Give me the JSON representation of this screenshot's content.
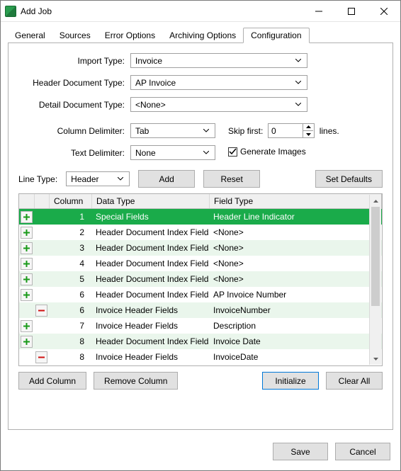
{
  "window": {
    "title": "Add Job"
  },
  "tabs": [
    "General",
    "Sources",
    "Error Options",
    "Archiving Options",
    "Configuration"
  ],
  "active_tab_index": 4,
  "form": {
    "import_type": {
      "label": "Import Type:",
      "value": "Invoice"
    },
    "header_doc_type": {
      "label": "Header Document Type:",
      "value": "AP Invoice"
    },
    "detail_doc_type": {
      "label": "Detail Document Type:",
      "value": "<None>"
    },
    "column_delim": {
      "label": "Column Delimiter:",
      "value": "Tab"
    },
    "text_delim": {
      "label": "Text Delimiter:",
      "value": "None"
    },
    "skip_first": {
      "label": "Skip first:",
      "value": "0",
      "suffix": "lines."
    },
    "generate_images": {
      "label": "Generate Images",
      "checked": true
    }
  },
  "linetype": {
    "label": "Line Type:",
    "value": "Header",
    "add_btn": "Add",
    "reset_btn": "Reset",
    "set_defaults_btn": "Set Defaults"
  },
  "grid": {
    "headers": {
      "column": "Column",
      "data_type": "Data Type",
      "field_type": "Field Type"
    },
    "rows": [
      {
        "icon": "plus",
        "col": 1,
        "data_type": "Special Fields",
        "field_type": "Header Line Indicator",
        "selected": true
      },
      {
        "icon": "plus",
        "col": 2,
        "data_type": "Header Document Index Fields",
        "field_type": "<None>"
      },
      {
        "icon": "plus",
        "col": 3,
        "data_type": "Header Document Index Fields",
        "field_type": "<None>"
      },
      {
        "icon": "plus",
        "col": 4,
        "data_type": "Header Document Index Fields",
        "field_type": "<None>"
      },
      {
        "icon": "plus",
        "col": 5,
        "data_type": "Header Document Index Fields",
        "field_type": "<None>"
      },
      {
        "icon": "plus",
        "col": 6,
        "data_type": "Header Document Index Fields",
        "field_type": "AP Invoice Number"
      },
      {
        "icon": "minus",
        "col": 6,
        "data_type": "Invoice Header Fields",
        "field_type": "InvoiceNumber",
        "indent": true
      },
      {
        "icon": "plus",
        "col": 7,
        "data_type": "Invoice Header Fields",
        "field_type": "Description"
      },
      {
        "icon": "plus",
        "col": 8,
        "data_type": "Header Document Index Fields",
        "field_type": "Invoice Date"
      },
      {
        "icon": "minus",
        "col": 8,
        "data_type": "Invoice Header Fields",
        "field_type": "InvoiceDate",
        "indent": true
      }
    ]
  },
  "buttons": {
    "add_column": "Add Column",
    "remove_column": "Remove Column",
    "initialize": "Initialize",
    "clear_all": "Clear All",
    "save": "Save",
    "cancel": "Cancel"
  }
}
